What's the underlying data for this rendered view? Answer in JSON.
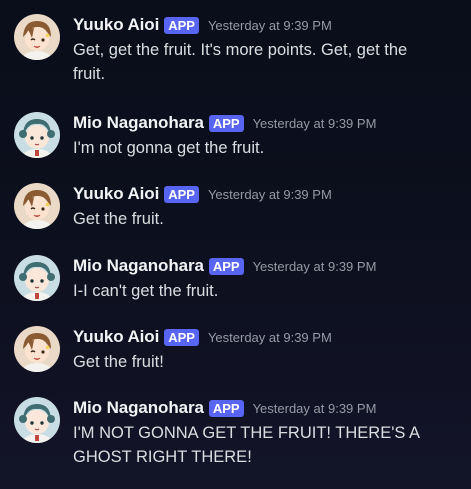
{
  "badge_label": "APP",
  "colors": {
    "background": "#0c0f1d",
    "badge": "#5865f2",
    "username": "#f2f3f5",
    "message_text": "#dbdee1",
    "timestamp": "#949ba4"
  },
  "messages": [
    {
      "author": "Yuuko Aioi",
      "timestamp": "Yesterday at 9:39 PM",
      "text": "Get, get the fruit. It's more points. Get, get the fruit.",
      "avatar": "yuuko-avatar"
    },
    {
      "author": "Mio Naganohara",
      "timestamp": "Yesterday at 9:39 PM",
      "text": "I'm not gonna get the fruit.",
      "avatar": "mio-avatar"
    },
    {
      "author": "Yuuko Aioi",
      "timestamp": "Yesterday at 9:39 PM",
      "text": "Get the fruit.",
      "avatar": "yuuko-avatar"
    },
    {
      "author": "Mio Naganohara",
      "timestamp": "Yesterday at 9:39 PM",
      "text": "I-I can't get the fruit.",
      "avatar": "mio-avatar"
    },
    {
      "author": "Yuuko Aioi",
      "timestamp": "Yesterday at 9:39 PM",
      "text": "Get the fruit!",
      "avatar": "yuuko-avatar"
    },
    {
      "author": "Mio Naganohara",
      "timestamp": "Yesterday at 9:39 PM",
      "text": "I'M NOT GONNA GET THE FRUIT! THERE'S A GHOST RIGHT THERE!",
      "avatar": "mio-avatar"
    }
  ]
}
